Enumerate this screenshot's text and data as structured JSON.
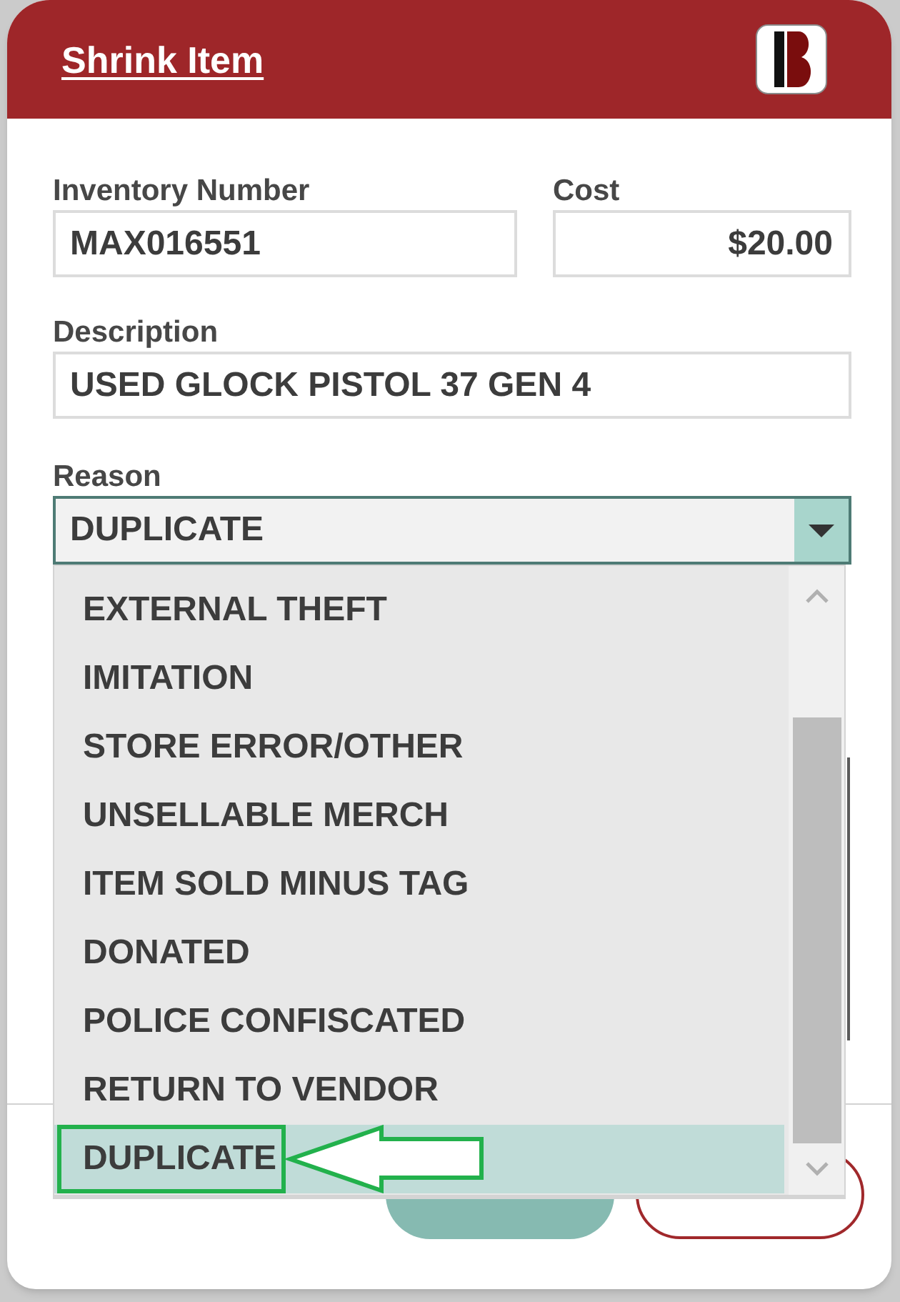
{
  "dialog": {
    "title": "Shrink Item"
  },
  "inventory_number": {
    "label": "Inventory Number",
    "value": "MAX016551"
  },
  "cost": {
    "label": "Cost",
    "value": "$20.00"
  },
  "description": {
    "label": "Description",
    "value": "USED GLOCK PISTOL 37 GEN 4"
  },
  "reason": {
    "label": "Reason",
    "value": "DUPLICATE",
    "expanded": true,
    "options": [
      {
        "label": "EXTERNAL THEFT",
        "selected": false,
        "highlighted": false
      },
      {
        "label": "IMITATION",
        "selected": false,
        "highlighted": false
      },
      {
        "label": "STORE ERROR/OTHER",
        "selected": false,
        "highlighted": false
      },
      {
        "label": "UNSELLABLE MERCH",
        "selected": false,
        "highlighted": false
      },
      {
        "label": "ITEM SOLD MINUS TAG",
        "selected": false,
        "highlighted": false
      },
      {
        "label": "DONATED",
        "selected": false,
        "highlighted": false
      },
      {
        "label": "POLICE CONFISCATED",
        "selected": false,
        "highlighted": false
      },
      {
        "label": "RETURN TO VENDOR",
        "selected": false,
        "highlighted": false
      },
      {
        "label": "DUPLICATE",
        "selected": true,
        "highlighted": true
      }
    ]
  },
  "footer_buttons": [
    {
      "kind": "primary"
    },
    {
      "kind": "secondary"
    }
  ]
}
